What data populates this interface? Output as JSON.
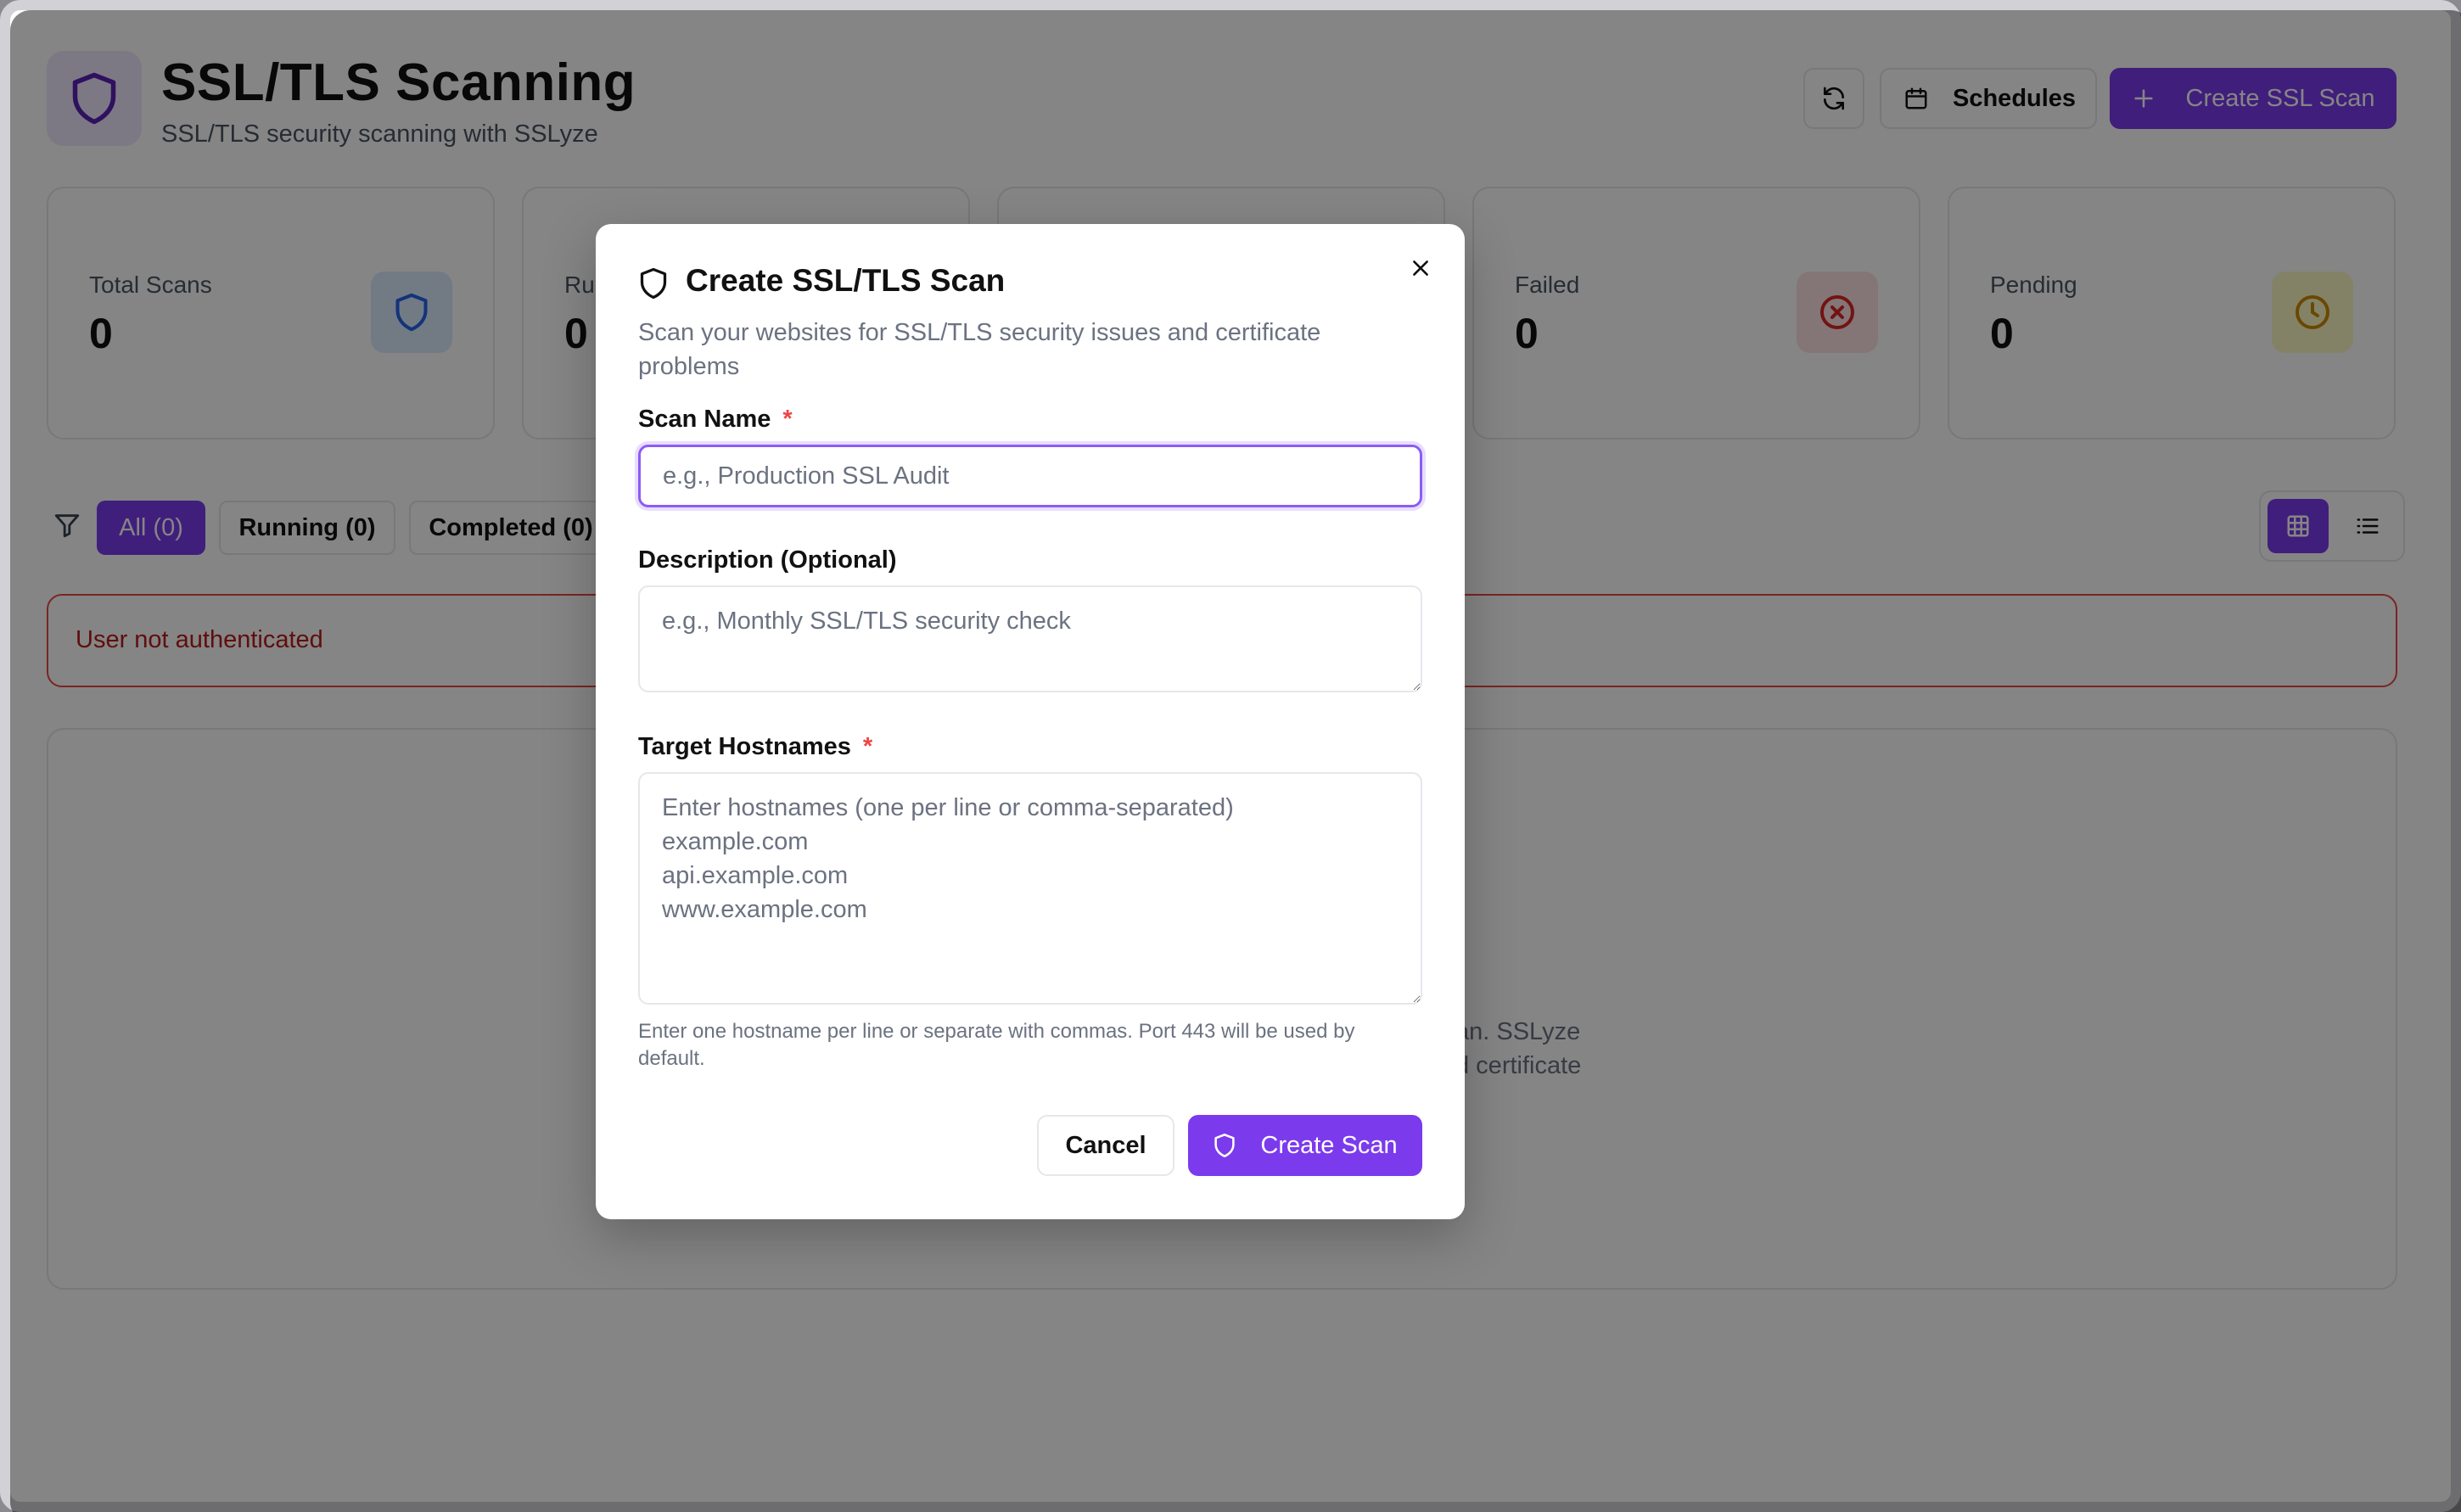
{
  "header": {
    "title": "SSL/TLS Scanning",
    "subtitle": "SSL/TLS security scanning with SSLyze",
    "schedules_label": "Schedules",
    "create_label": "Create SSL Scan"
  },
  "stats": [
    {
      "label": "Total Scans",
      "value": "0",
      "icon": "shield-icon"
    },
    {
      "label": "Ru",
      "value": "0",
      "icon": "activity-icon"
    },
    {
      "label": "",
      "value": "",
      "icon": ""
    },
    {
      "label": "Failed",
      "value": "0",
      "icon": "x-circle-icon"
    },
    {
      "label": "Pending",
      "value": "0",
      "icon": "clock-icon"
    }
  ],
  "filters": {
    "all": "All (0)",
    "running": "Running (0)",
    "completed": "Completed (0)"
  },
  "alert": {
    "message": "User not authenticated"
  },
  "empty_state": {
    "line1": "an. SSLyze",
    "line2": "d certificate"
  },
  "modal": {
    "title": "Create SSL/TLS Scan",
    "description": "Scan your websites for SSL/TLS security issues and certificate problems",
    "scan_name_label": "Scan Name",
    "scan_name_placeholder": "e.g., Production SSL Audit",
    "description_label": "Description (Optional)",
    "description_placeholder": "e.g., Monthly SSL/TLS security check",
    "hostnames_label": "Target Hostnames",
    "hostnames_placeholder": "Enter hostnames (one per line or comma-separated)\nexample.com\napi.example.com\nwww.example.com",
    "required_mark": "*",
    "help_text": "Enter one hostname per line or separate with commas. Port 443 will be used by default.",
    "cancel_label": "Cancel",
    "create_label": "Create Scan"
  },
  "colors": {
    "accent": "#7c3aed",
    "danger": "#ef4444",
    "warning": "#eab308",
    "info": "#2563eb"
  }
}
